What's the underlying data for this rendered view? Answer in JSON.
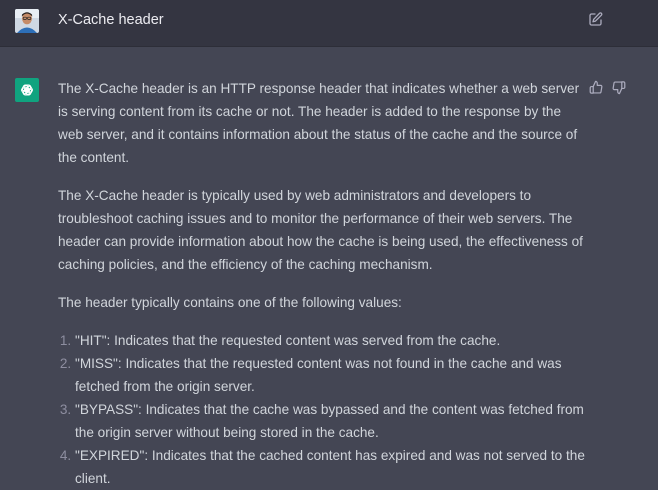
{
  "user_message": {
    "text": "X-Cache header"
  },
  "assistant_message": {
    "paragraphs": [
      "The X-Cache header is an HTTP response header that indicates whether a web server is serving content from its cache or not. The header is added to the response by the web server, and it contains information about the status of the cache and the source of the content.",
      "The X-Cache header is typically used by web administrators and developers to troubleshoot caching issues and to monitor the performance of their web servers. The header can provide information about how the cache is being used, the effectiveness of caching policies, and the efficiency of the caching mechanism.",
      "The header typically contains one of the following values:"
    ],
    "list": [
      "\"HIT\": Indicates that the requested content was served from the cache.",
      "\"MISS\": Indicates that the requested content was not found in the cache and was fetched from the origin server.",
      "\"BYPASS\": Indicates that the cache was bypassed and the content was fetched from the origin server without being stored in the cache.",
      "\"EXPIRED\": Indicates that the cached content has expired and was not served to the client."
    ]
  },
  "icons": {
    "user_avatar": "user-avatar",
    "edit": "edit-icon",
    "assistant": "openai-logo-icon",
    "like": "thumbs-up-icon",
    "dislike": "thumbs-down-icon"
  },
  "colors": {
    "user_bg": "#343541",
    "assistant_bg": "#444654",
    "brand": "#10a37f",
    "text": "#d1d5db"
  }
}
